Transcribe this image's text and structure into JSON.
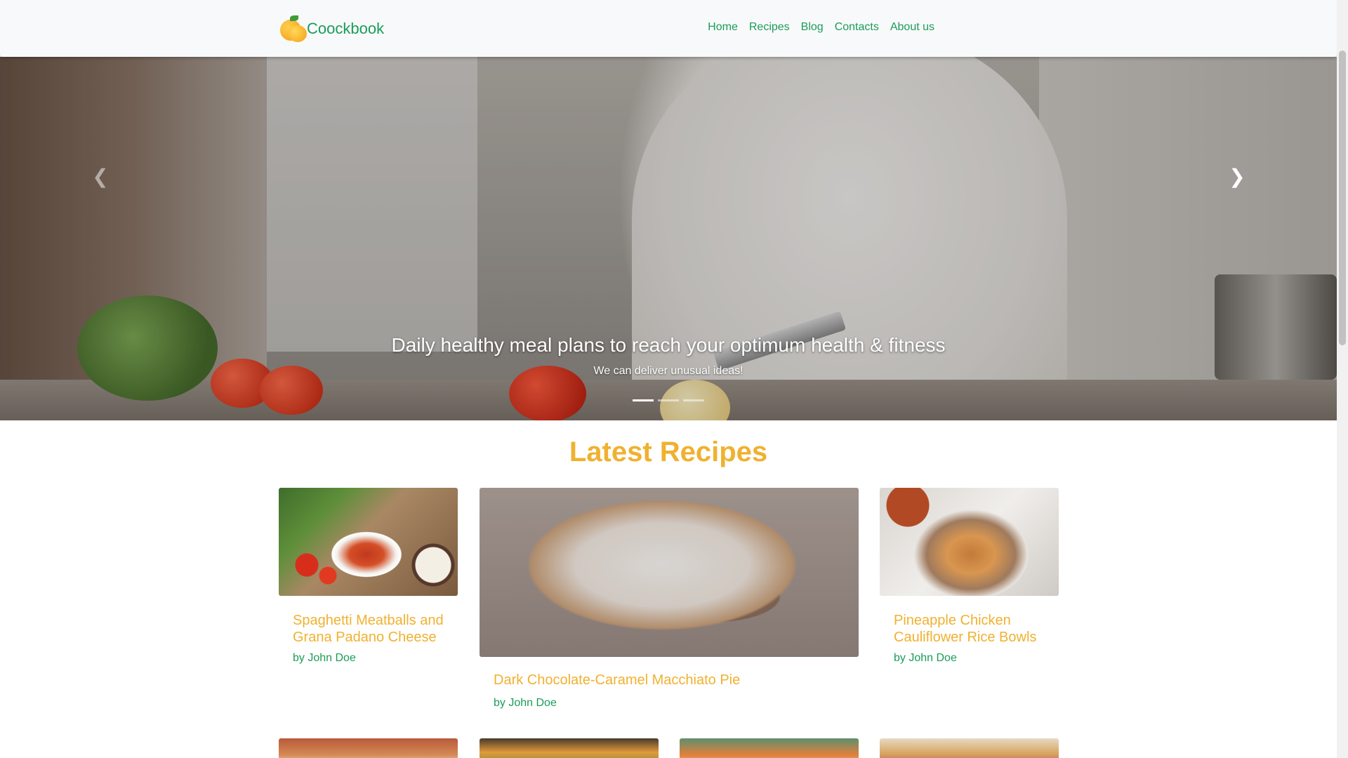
{
  "brand": {
    "name": "Coockbook",
    "logo_icon": "orange-fruit-icon"
  },
  "nav": {
    "links": [
      "Home",
      "Recipes",
      "Blog",
      "Contacts",
      "About us"
    ]
  },
  "carousel": {
    "caption_title": "Daily healthy meal plans to reach your optimum health & fitness",
    "caption_text": "We can deliver unusual ideas!",
    "prev_icon": "chevron-left-icon",
    "next_icon": "chevron-right-icon",
    "slides_count": 3,
    "active_slide": 1
  },
  "latest": {
    "heading": "Latest Recipes",
    "recipes": [
      {
        "title": "Spaghetti Meatballs and Grana Padano Cheese",
        "author": "by John Doe"
      },
      {
        "title": "Dark Chocolate-Caramel Macchiato Pie",
        "author": "by John Doe"
      },
      {
        "title": "Pineapple Chicken Cauliflower Rice Bowls",
        "author": "by John Doe"
      }
    ]
  },
  "colors": {
    "accent_green": "#1a9c5a",
    "accent_orange": "#f0b130",
    "navbar_bg": "#f8f9fa"
  }
}
